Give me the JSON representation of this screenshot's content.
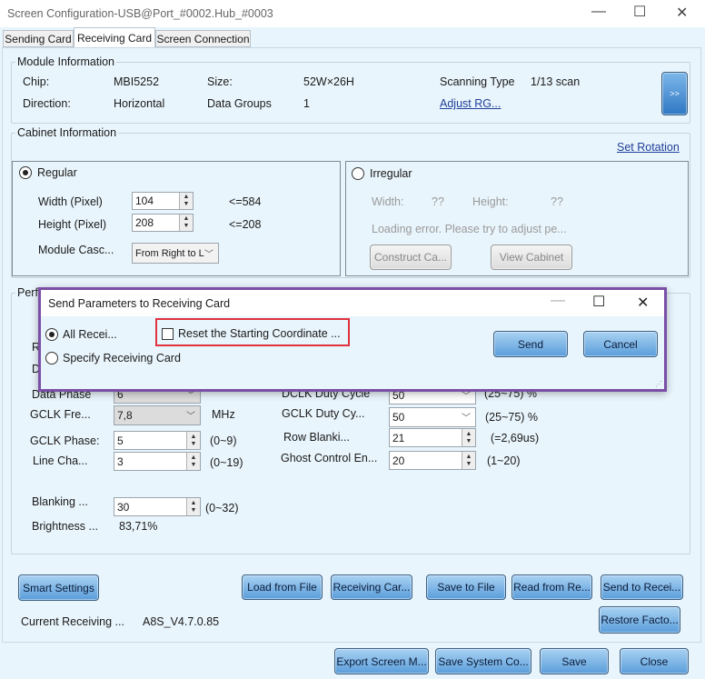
{
  "window": {
    "title": "Screen Configuration-USB@Port_#0002.Hub_#0003",
    "minimize": "—",
    "maximize": "☐",
    "close": "✕"
  },
  "tabs": [
    {
      "label": "Sending Card"
    },
    {
      "label": "Receiving Card",
      "active": true
    },
    {
      "label": "Screen Connection"
    }
  ],
  "module": {
    "title": "Module Information",
    "chip_label": "Chip:",
    "chip": "MBI5252",
    "size_label": "Size:",
    "size": "52W×26H",
    "scan_label": "Scanning Type",
    "scan": "1/13 scan",
    "direction_label": "Direction:",
    "direction": "Horizontal",
    "groups_label": "Data Groups",
    "groups": "1",
    "adjust_link": "Adjust RG...",
    "more_button": ">>"
  },
  "cabinet": {
    "title": "Cabinet Information",
    "set_rotation": "Set Rotation",
    "regular": {
      "label": "Regular",
      "selected": true,
      "width_label": "Width (Pixel)",
      "width": "104",
      "width_max": "<=584",
      "height_label": "Height (Pixel)",
      "height": "208",
      "height_max": "<=208",
      "cascade_label": "Module Casc...",
      "cascade": "From Right to L"
    },
    "irregular": {
      "label": "Irregular",
      "selected": false,
      "width_label": "Width:",
      "width": "??",
      "height_label": "Height:",
      "height": "??",
      "error": "Loading error. Please try to adjust pe...",
      "construct": "Construct Ca...",
      "view": "View Cabinet"
    }
  },
  "performance": {
    "title": "Perf",
    "hidden_r": "R",
    "hidden_d": "D",
    "data_phase_label": "Data Phase",
    "data_phase": "6",
    "gclk_freq_label": "GCLK Fre...",
    "gclk_freq": "7,8",
    "gclk_freq_unit": "MHz",
    "gclk_phase_label": "GCLK Phase:",
    "gclk_phase": "5",
    "gclk_phase_range": "(0~9)",
    "line_label": "Line Cha...",
    "line": "3",
    "line_range": "(0~19)",
    "blanking_label": "Blanking ...",
    "blanking": "30",
    "blanking_range": "(0~32)",
    "brightness_label": "Brightness ...",
    "brightness": "83,71%",
    "dclk_duty_label": "DCLK Duty Cycle",
    "dclk_duty": "50",
    "dclk_duty_range": "(25~75) %",
    "gclk_duty_label": "GCLK Duty Cy...",
    "gclk_duty": "50",
    "gclk_duty_range": "(25~75) %",
    "row_blank_label": "Row Blanki...",
    "row_blank": "21",
    "row_blank_note": "(=2,69us)",
    "ghost_label": "Ghost Control En...",
    "ghost": "20",
    "ghost_range": "(1~20)"
  },
  "actions": {
    "smart": "Smart Settings",
    "load": "Load from File",
    "receiving": "Receiving Car...",
    "save_file": "Save to File",
    "read": "Read from Re...",
    "send": "Send to Recei...",
    "restore": "Restore Facto...",
    "current_label": "Current Receiving ...",
    "current": "A8S_V4.7.0.85"
  },
  "footer": {
    "export": "Export Screen M...",
    "save_sys": "Save System Co...",
    "save": "Save",
    "close": "Close"
  },
  "dialog": {
    "title": "Send Parameters to Receiving Card",
    "all": "All Recei...",
    "all_selected": true,
    "specify": "Specify Receiving Card",
    "reset": "Reset the Starting Coordinate ...",
    "reset_checked": false,
    "send": "Send",
    "cancel": "Cancel",
    "minimize": "—",
    "maximize": "☐",
    "close": "✕",
    "border_color": "#7b4fa6",
    "highlight_color": "#e0323c"
  }
}
